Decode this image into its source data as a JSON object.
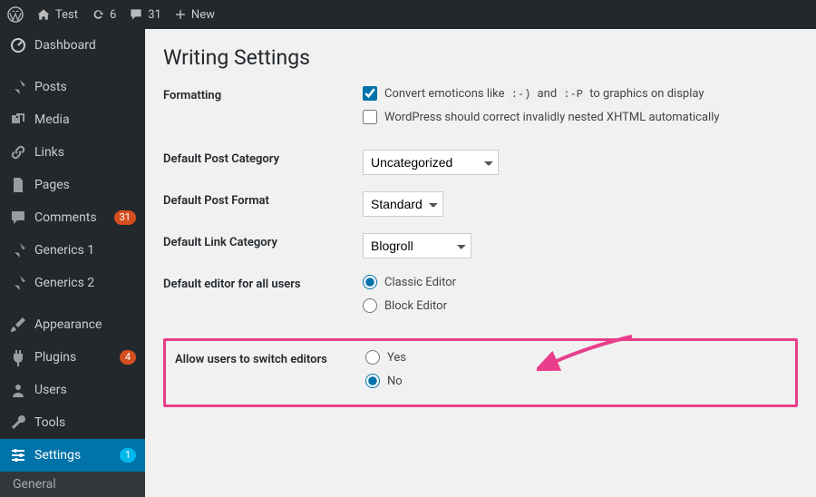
{
  "adminbar": {
    "site": "Test",
    "updates": "6",
    "comments": "31",
    "new": "New"
  },
  "menu": {
    "dashboard": "Dashboard",
    "posts": "Posts",
    "media": "Media",
    "links": "Links",
    "pages": "Pages",
    "comments": "Comments",
    "comments_badge": "31",
    "generics1": "Generics 1",
    "generics2": "Generics 2",
    "appearance": "Appearance",
    "plugins": "Plugins",
    "plugins_badge": "4",
    "users": "Users",
    "tools": "Tools",
    "settings": "Settings",
    "settings_badge": "1",
    "sub_general": "General"
  },
  "page": {
    "title": "Writing Settings",
    "formatting_label": "Formatting",
    "formatting1_a": "Convert emoticons like",
    "emoticon1": ":-)",
    "formatting1_b": "and",
    "emoticon2": ":-P",
    "formatting1_c": "to graphics on display",
    "formatting2": "WordPress should correct invalidly nested XHTML automatically",
    "defcat_label": "Default Post Category",
    "defcat_value": "Uncategorized",
    "deffmt_label": "Default Post Format",
    "deffmt_value": "Standard",
    "deflink_label": "Default Link Category",
    "deflink_value": "Blogroll",
    "defeditor_label": "Default editor for all users",
    "ed_classic": "Classic Editor",
    "ed_block": "Block Editor",
    "allowswitch_label": "Allow users to switch editors",
    "yes": "Yes",
    "no": "No"
  }
}
